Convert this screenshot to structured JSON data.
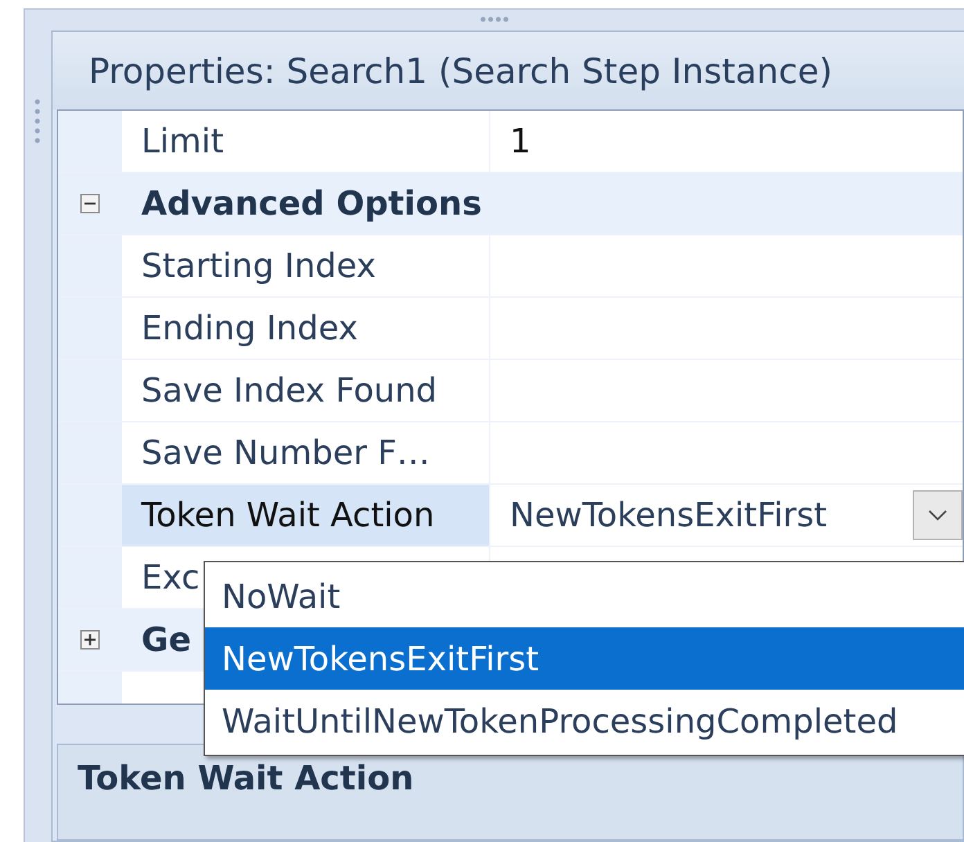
{
  "panel": {
    "title": "Properties: Search1 (Search Step Instance)"
  },
  "rows": [
    {
      "kind": "property",
      "label": "Limit",
      "value": "1",
      "selected": false
    },
    {
      "kind": "category",
      "label": "Advanced Options",
      "expanded": true
    },
    {
      "kind": "property",
      "label": "Starting Index",
      "selected": false
    },
    {
      "kind": "property",
      "label": "Ending Index",
      "selected": false
    },
    {
      "kind": "property",
      "label": "Save Index Found",
      "selected": false
    },
    {
      "kind": "property",
      "label": "Save Number F…",
      "selected": false
    },
    {
      "kind": "dropdown",
      "label": "Token Wait Action",
      "value": "NewTokensExitFirst",
      "selected": true
    },
    {
      "kind": "property",
      "label": "Exc",
      "selected": false
    },
    {
      "kind": "category",
      "label": "Ge",
      "expanded": false
    }
  ],
  "dropdown_options": [
    {
      "label": "NoWait",
      "selected": false
    },
    {
      "label": "NewTokensExitFirst",
      "selected": true
    },
    {
      "label": "WaitUntilNewTokenProcessingCompleted",
      "selected": false
    }
  ],
  "description": {
    "title": "Token Wait Action"
  }
}
